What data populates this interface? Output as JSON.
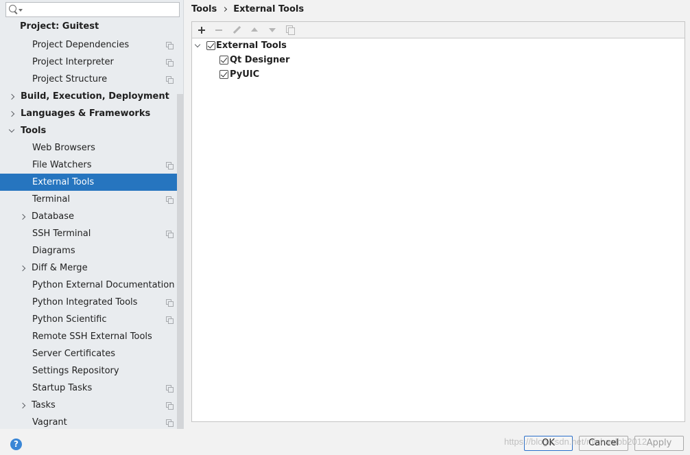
{
  "search": {
    "placeholder": "",
    "value": ""
  },
  "sidebar": {
    "items": [
      {
        "label": "Project: Guitest",
        "level": 0,
        "bold": true
      },
      {
        "label": "Project Dependencies",
        "level": 1,
        "copy_icon": true
      },
      {
        "label": "Project Interpreter",
        "level": 1,
        "copy_icon": true
      },
      {
        "label": "Project Structure",
        "level": 1,
        "copy_icon": true
      },
      {
        "label": "Build, Execution, Deployment",
        "level": 0,
        "bold": true,
        "arrow": "right"
      },
      {
        "label": "Languages & Frameworks",
        "level": 0,
        "bold": true,
        "arrow": "right"
      },
      {
        "label": "Tools",
        "level": 0,
        "bold": true,
        "arrow": "down"
      },
      {
        "label": "Web Browsers",
        "level": 1
      },
      {
        "label": "File Watchers",
        "level": 1,
        "copy_icon": true
      },
      {
        "label": "External Tools",
        "level": 1,
        "selected": true
      },
      {
        "label": "Terminal",
        "level": 1,
        "copy_icon": true
      },
      {
        "label": "Database",
        "level": 1,
        "arrow": "right"
      },
      {
        "label": "SSH Terminal",
        "level": 1,
        "copy_icon": true
      },
      {
        "label": "Diagrams",
        "level": 1
      },
      {
        "label": "Diff & Merge",
        "level": 1,
        "arrow": "right"
      },
      {
        "label": "Python External Documentation",
        "level": 1
      },
      {
        "label": "Python Integrated Tools",
        "level": 1,
        "copy_icon": true
      },
      {
        "label": "Python Scientific",
        "level": 1,
        "copy_icon": true
      },
      {
        "label": "Remote SSH External Tools",
        "level": 1
      },
      {
        "label": "Server Certificates",
        "level": 1
      },
      {
        "label": "Settings Repository",
        "level": 1
      },
      {
        "label": "Startup Tasks",
        "level": 1,
        "copy_icon": true
      },
      {
        "label": "Tasks",
        "level": 1,
        "arrow": "right",
        "copy_icon": true
      },
      {
        "label": "Vagrant",
        "level": 1,
        "copy_icon": true
      }
    ]
  },
  "breadcrumb": {
    "parent": "Tools",
    "current": "External Tools"
  },
  "toolbar": {
    "add_icon": "plus-icon",
    "remove_icon": "minus-icon",
    "edit_icon": "pencil-icon",
    "up_icon": "arrow-up-icon",
    "down_icon": "arrow-down-icon",
    "copy_icon": "copy-icon"
  },
  "tools_tree": {
    "group": {
      "label": "External Tools",
      "checked": true,
      "expanded": true
    },
    "children": [
      {
        "label": "Qt Designer",
        "checked": true
      },
      {
        "label": "PyUIC",
        "checked": true
      }
    ]
  },
  "footer": {
    "help": "?",
    "ok": "OK",
    "cancel": "Cancel",
    "apply": "Apply",
    "watermark": "https://blog.csdn.net/michaelbb2012"
  },
  "colors": {
    "selection": "#2675bf",
    "sidebar_bg": "#e9ecef",
    "ok_border": "#2a6fc9"
  }
}
